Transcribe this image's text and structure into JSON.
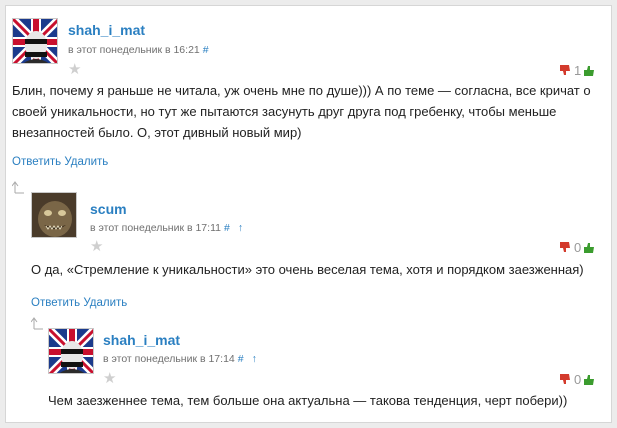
{
  "comments": [
    {
      "author": "shah_i_mat",
      "timestamp": "в этот понедельник в 16:21",
      "anchor": "#",
      "rating": "1",
      "text": "Блин, почему я раньше не читала, уж очень мне по душе))) А по теме — согласна, все кричат о своей уникальности, но тут же пытаются засунуть друг друга под гребенку, чтобы меньше внезапностей было. О, этот дивный новый мир)",
      "actions": [
        "Ответить",
        "Удалить"
      ]
    },
    {
      "author": "scum",
      "timestamp": "в этот понедельник в 17:11",
      "anchor": "#",
      "parent_link": "↑",
      "rating": "0",
      "text": "О да, «Стремление к уникальности» это очень веселая тема, хотя и порядком заезженная)",
      "actions": [
        "Ответить",
        "Удалить"
      ]
    },
    {
      "author": "shah_i_mat",
      "timestamp": "в этот понедельник в 17:14",
      "anchor": "#",
      "parent_link": "↑",
      "rating": "0",
      "text": "Чем заезженнее тема, тем больше она актуальна — такова тенденция, черт побери))"
    }
  ],
  "icons": {
    "favorite": "star-icon",
    "vote_down": "thumb-down-icon",
    "vote_up": "thumb-up-icon",
    "reply_indicator": "reply-arrow-icon"
  },
  "colors": {
    "link": "#2a7fc1",
    "vote_down": "#d33a2c",
    "vote_up": "#3b9c2e",
    "meta": "#6f6f6f"
  }
}
